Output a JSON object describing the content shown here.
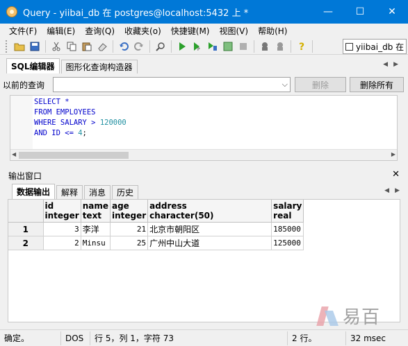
{
  "window": {
    "title": "Query - yiibai_db 在  postgres@localhost:5432 上 *",
    "minimize": "—",
    "maximize": "☐",
    "close": "✕"
  },
  "menu": [
    "文件(F)",
    "编辑(E)",
    "查询(Q)",
    "收藏夹(o)",
    "快捷键(M)",
    "视图(V)",
    "帮助(H)"
  ],
  "toolbar": {
    "database": "yiibai_db 在"
  },
  "query_tabs": [
    "SQL编辑器",
    "图形化查询构造器"
  ],
  "previous_query": {
    "label": "以前的查询",
    "value": "",
    "delete_label": "删除",
    "delete_all_label": "删除所有"
  },
  "editor": {
    "lines": [
      {
        "kw": "SELECT *",
        "rest": "",
        "num": ""
      },
      {
        "kw": "FROM EMPLOYEES",
        "rest": "",
        "num": ""
      },
      {
        "kw": "WHERE SALARY > ",
        "rest": "",
        "num": "120000"
      },
      {
        "kw": "AND ID <= ",
        "rest": ";",
        "num": "4"
      }
    ]
  },
  "output": {
    "title": "输出窗口",
    "close": "✕",
    "tabs": [
      "数据输出",
      "解释",
      "消息",
      "历史"
    ],
    "columns": [
      {
        "name": "id",
        "type": "integer"
      },
      {
        "name": "name",
        "type": "text"
      },
      {
        "name": "age",
        "type": "integer"
      },
      {
        "name": "address",
        "type": "character(50)"
      },
      {
        "name": "salary",
        "type": "real"
      }
    ],
    "rows": [
      {
        "num": "1",
        "id": "3",
        "name": "李洋",
        "age": "21",
        "address": "北京市朝阳区",
        "salary": "185000"
      },
      {
        "num": "2",
        "id": "2",
        "name": "Minsu",
        "age": "25",
        "address": "广州中山大道",
        "salary": "125000"
      }
    ]
  },
  "watermark": {
    "text": "易百"
  },
  "status": {
    "state": "确定。",
    "encoding": "DOS",
    "position": "行 5，列 1，字符 73",
    "rows": "2 行。",
    "time": "32 msec"
  }
}
